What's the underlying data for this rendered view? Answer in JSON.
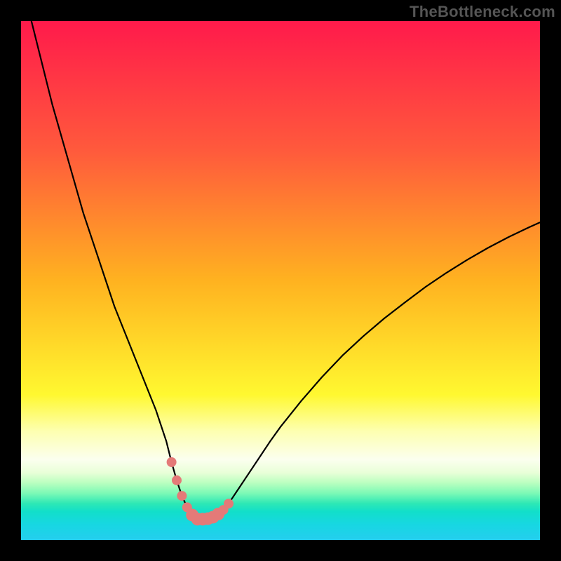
{
  "attribution": "TheBottleneck.com",
  "colors": {
    "page_bg": "#000000",
    "curve_stroke": "#000000",
    "marker_fill": "#e47a78",
    "gradient_top": "#ff1a4b",
    "gradient_bottom": "#24ceee"
  },
  "chart_data": {
    "type": "line",
    "title": "",
    "xlabel": "",
    "ylabel": "",
    "xlim": [
      0,
      100
    ],
    "ylim": [
      0,
      100
    ],
    "bottleneck_min_x": 34,
    "series": [
      {
        "name": "bottleneck-curve",
        "x": [
          2,
          4,
          6,
          8,
          10,
          12,
          14,
          16,
          18,
          20,
          22,
          24,
          26,
          28,
          29,
          30,
          31,
          32,
          33,
          34,
          35,
          36,
          37,
          38,
          39,
          40,
          42,
          44,
          46,
          48,
          50,
          52,
          54,
          58,
          62,
          66,
          70,
          74,
          78,
          82,
          86,
          90,
          94,
          98,
          100
        ],
        "values": [
          100,
          92,
          84,
          77,
          70,
          63,
          57,
          51,
          45,
          40,
          35,
          30,
          25,
          19,
          15,
          11.5,
          8.5,
          6.3,
          4.8,
          4.0,
          4.0,
          4.1,
          4.4,
          5.0,
          5.8,
          7.0,
          10.0,
          13.0,
          16.0,
          19.0,
          21.8,
          24.3,
          26.8,
          31.4,
          35.6,
          39.3,
          42.7,
          45.8,
          48.8,
          51.5,
          54.0,
          56.3,
          58.4,
          60.3,
          61.2
        ]
      }
    ],
    "markers": {
      "name": "highlight-range",
      "x": [
        29,
        30,
        31,
        32,
        33,
        34,
        35,
        36,
        37,
        38,
        39,
        40
      ],
      "values": [
        15,
        11.5,
        8.5,
        6.3,
        4.8,
        4.0,
        4.0,
        4.1,
        4.4,
        5.0,
        5.8,
        7.0
      ]
    }
  }
}
